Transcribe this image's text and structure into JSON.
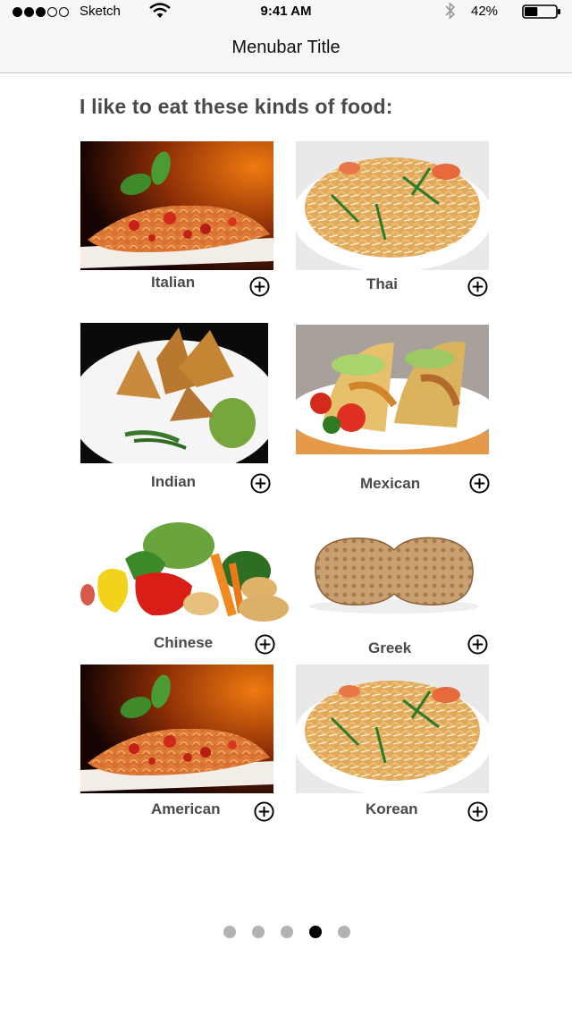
{
  "status_bar": {
    "signal_dots_filled": 3,
    "signal_dots_total": 5,
    "carrier": "Sketch",
    "wifi_icon": "wifi-icon",
    "time": "9:41 AM",
    "bluetooth_icon": "bluetooth-icon",
    "battery_percent": "42%",
    "battery_level": 0.42
  },
  "nav_bar": {
    "title": "Menubar Title"
  },
  "heading": "I like to eat these kinds of food:",
  "foods": [
    {
      "label": "Italian",
      "photo": "spaghetti-photo",
      "add_icon": "plus-circle-icon"
    },
    {
      "label": "Thai",
      "photo": "pad-thai-photo",
      "add_icon": "plus-circle-icon"
    },
    {
      "label": "Indian",
      "photo": "samosa-photo",
      "add_icon": "plus-circle-icon"
    },
    {
      "label": "Mexican",
      "photo": "tacos-photo",
      "add_icon": "plus-circle-icon"
    },
    {
      "label": "Chinese",
      "photo": "vegetables-photo",
      "add_icon": "plus-circle-icon"
    },
    {
      "label": "Greek",
      "photo": "peanut-photo",
      "add_icon": "plus-circle-icon"
    },
    {
      "label": "American",
      "photo": "spaghetti-photo",
      "add_icon": "plus-circle-icon"
    },
    {
      "label": "Korean",
      "photo": "pad-thai-photo",
      "add_icon": "plus-circle-icon"
    }
  ],
  "page_control": {
    "pages": 5,
    "current_page": 4
  },
  "colors": {
    "label_gray": "#4a4a4a",
    "bar_bg": "#f7f7f7",
    "dot_inactive": "#b3b3b3",
    "dot_active": "#000000"
  }
}
